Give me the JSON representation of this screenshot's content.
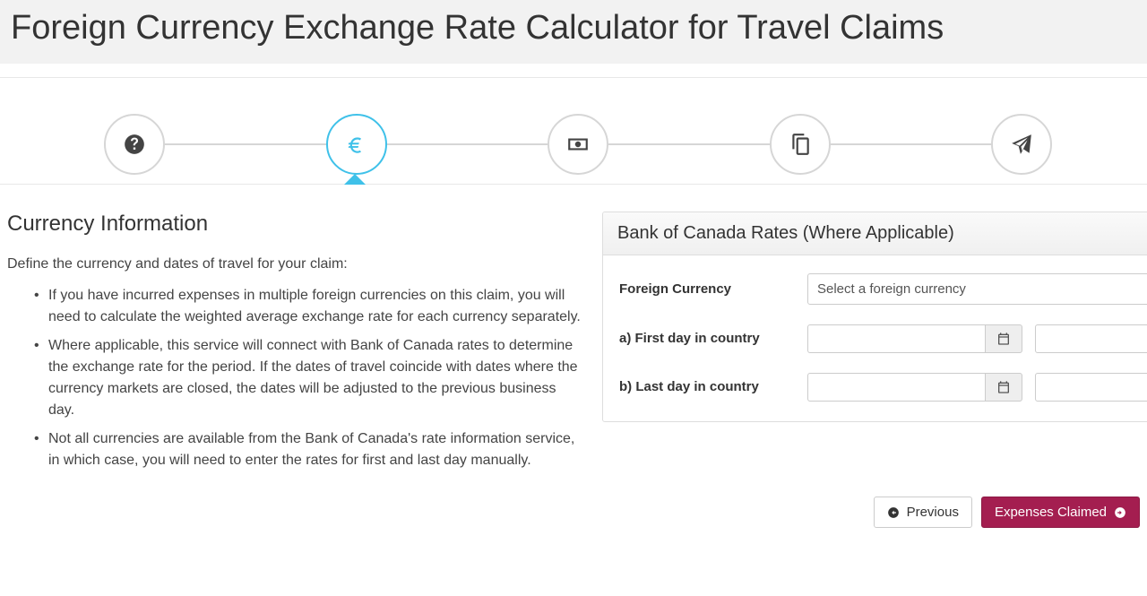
{
  "title": "Foreign Currency Exchange Rate Calculator for Travel Claims",
  "wizard": {
    "steps": [
      "help",
      "currency",
      "money",
      "copy",
      "send"
    ],
    "active_index": 1
  },
  "left": {
    "heading": "Currency Information",
    "intro": "Define the currency and dates of travel for your claim:",
    "bullets": [
      "If you have incurred expenses in multiple foreign currencies on this claim, you will need to calculate the weighted average exchange rate for each currency separately.",
      "Where applicable, this service will connect with Bank of Canada rates to determine the exchange rate for the period. If the dates of travel coincide with dates where the currency markets are closed, the dates will be adjusted to the previous business day.",
      "Not all currencies are available from the Bank of Canada's rate information service, in which case, you will need to enter the rates for first and last day manually."
    ]
  },
  "panel": {
    "header": "Bank of Canada Rates (Where Applicable)",
    "currency_label": "Foreign Currency",
    "currency_placeholder": "Select a foreign currency",
    "first_label": "a) First day in country",
    "last_label": "b) Last day in country",
    "first_date_value": "",
    "first_rate_value": "",
    "last_date_value": "",
    "last_rate_value": ""
  },
  "footer": {
    "previous": "Previous",
    "next": "Expenses Claimed"
  }
}
